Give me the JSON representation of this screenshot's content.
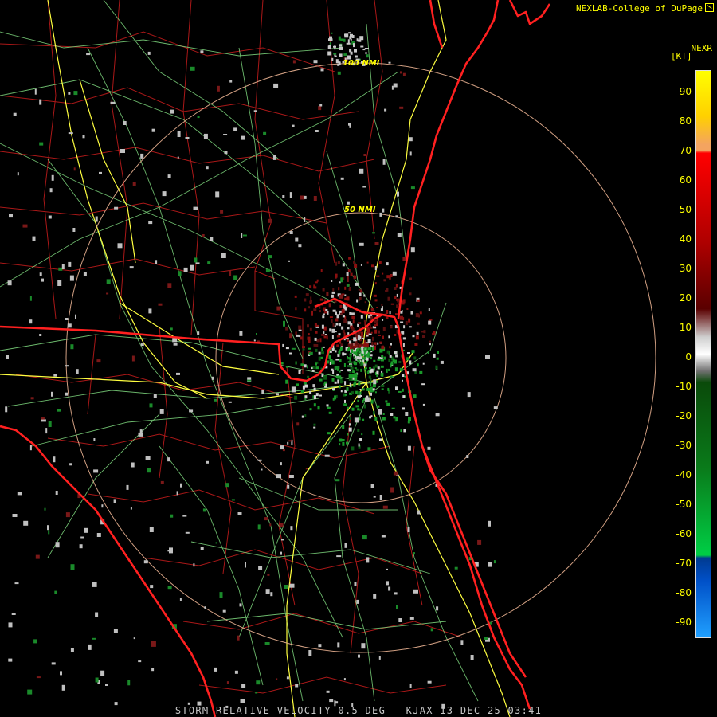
{
  "credit": "NEXLAB-College of DuPage",
  "legend": {
    "product": "NEXR",
    "unit": "[KT]",
    "ticks": [
      "90",
      "80",
      "70",
      "60",
      "50",
      "40",
      "30",
      "20",
      "10",
      "0",
      "-10",
      "-20",
      "-30",
      "-40",
      "-50",
      "-60",
      "-70",
      "-80",
      "-90"
    ],
    "colors": {
      "top": "#ffff00",
      "orange": "#f4a460",
      "red": "#ff0000",
      "dark_red": "#5a0000",
      "zero_gray": "#cfcfcf",
      "dark_green": "#0a4a0a",
      "green": "#00cc44",
      "blue": "#0050c8",
      "light_blue": "#20a0ff"
    }
  },
  "rings": [
    {
      "label": "50 NMI"
    },
    {
      "label": "100 NMI"
    }
  ],
  "footer": "STORM RELATIVE VELOCITY 0.5 DEG - KJAX 13 DEC 25 03:41",
  "colors": {
    "background": "#000000",
    "state_border": "#ff2020",
    "county_lines": "#aa1818",
    "highways": "#ffff40",
    "roads": "#88e888",
    "range_rings": "#e8b090"
  }
}
